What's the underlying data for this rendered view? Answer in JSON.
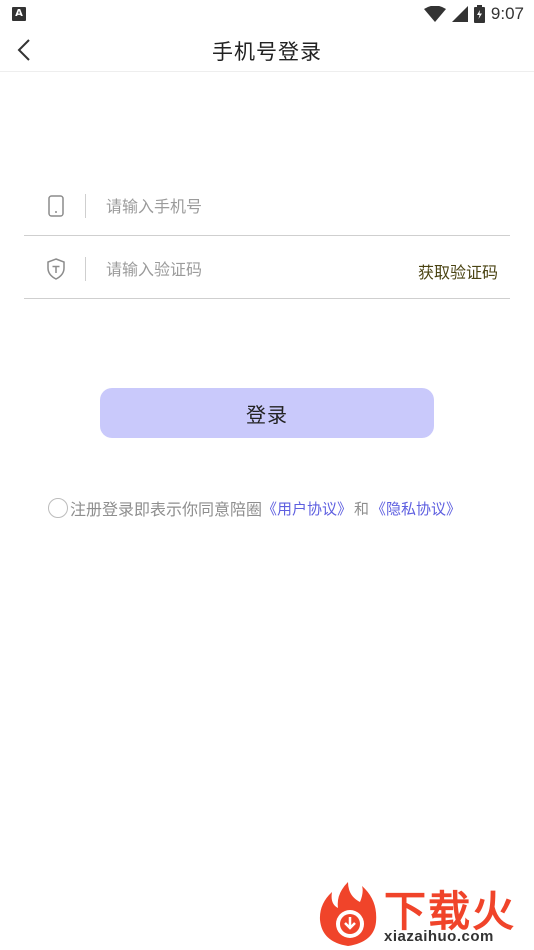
{
  "status_bar": {
    "notification_icon": "A",
    "time": "9:07",
    "icons": [
      "wifi-icon",
      "signal-icon",
      "battery-icon"
    ]
  },
  "header": {
    "title": "手机号登录",
    "back_icon": "chevron-left-icon"
  },
  "form": {
    "phone": {
      "placeholder": "请输入手机号",
      "value": "",
      "icon": "phone-icon"
    },
    "code": {
      "placeholder": "请输入验证码",
      "value": "",
      "icon": "shield-icon",
      "get_code_label": "获取验证码"
    }
  },
  "login_button": {
    "label": "登录"
  },
  "agreement": {
    "checked": false,
    "text": "注册登录即表示你同意陪圈",
    "user_agreement": "《用户协议》",
    "and": "和",
    "privacy_agreement": "《隐私协议》"
  },
  "watermark": {
    "name": "下载火",
    "url": "xiazaihuo.com"
  },
  "colors": {
    "accent": "#c9c9fb",
    "link": "#5e5fe0",
    "get_code": "#4a4312",
    "watermark": "#f0442a"
  }
}
